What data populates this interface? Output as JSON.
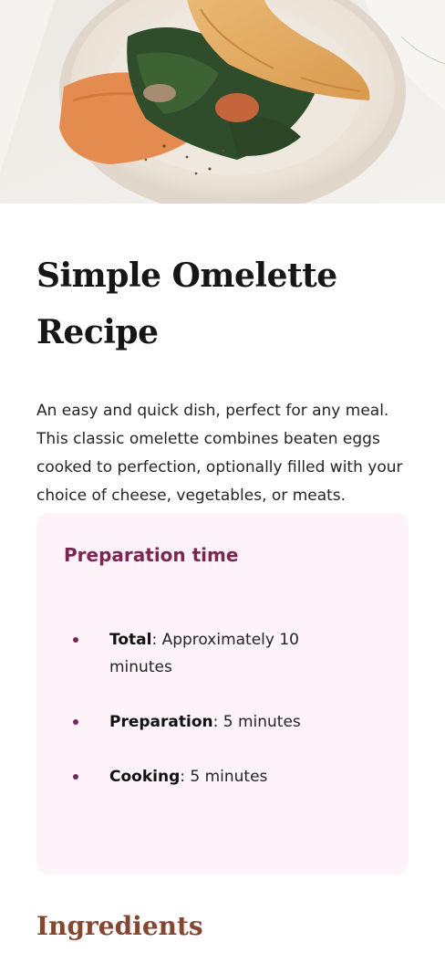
{
  "recipe": {
    "title": "Simple Omelette Recipe",
    "intro": "An easy and quick dish, perfect for any meal. This classic omelette combines beaten eggs cooked to perfection, optionally filled with your choice of cheese, vegetables, or meats."
  },
  "preparation": {
    "heading": "Preparation time",
    "items": [
      {
        "label": "Total",
        "value": ": Approximately 10 minutes"
      },
      {
        "label": "Preparation",
        "value": ": 5 minutes"
      },
      {
        "label": "Cooking",
        "value": ": 5 minutes"
      }
    ]
  },
  "ingredients": {
    "heading": "Ingredients"
  },
  "colors": {
    "prep_card_bg": "#fdf3f9",
    "prep_accent": "#7a2851",
    "ingredients_heading": "#854632"
  }
}
